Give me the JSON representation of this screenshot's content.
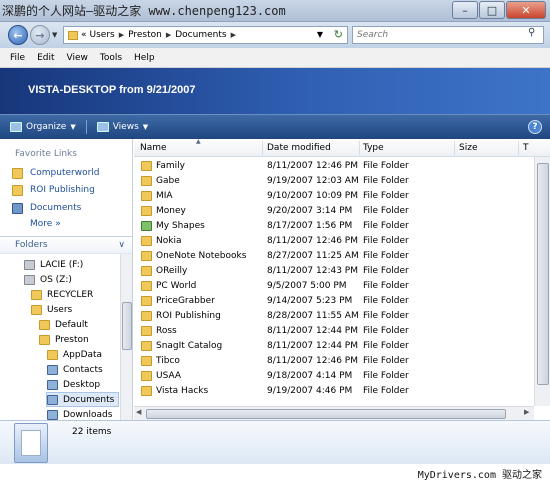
{
  "titlebar": {
    "watermark": "深鹏的个人网站—驱动之家 www.chenpeng123.com"
  },
  "address": {
    "prefix": "«",
    "crumbs": [
      "Users",
      "Preston",
      "Documents"
    ],
    "search_placeholder": "Search"
  },
  "menu": [
    "File",
    "Edit",
    "View",
    "Tools",
    "Help"
  ],
  "banner": {
    "title": "VISTA-DESKTOP from 9/21/2007"
  },
  "toolbar": {
    "organize": "Organize",
    "views": "Views",
    "help": "?"
  },
  "favorites": {
    "title": "Favorite Links",
    "items": [
      "Computerworld",
      "ROI Publishing",
      "Documents"
    ],
    "more": "More",
    "more_glyph": "»"
  },
  "folders": {
    "title": "Folders",
    "tree": [
      "LACIE (F:)",
      "OS (Z:)",
      "RECYCLER",
      "Users",
      "Default",
      "Preston",
      "AppData",
      "Contacts",
      "Desktop",
      "Documents",
      "Downloads"
    ]
  },
  "columns": [
    "Name",
    "Date modified",
    "Type",
    "Size",
    "T"
  ],
  "files": [
    {
      "name": "Family",
      "date": "8/11/2007 12:46 PM",
      "type": "File Folder"
    },
    {
      "name": "Gabe",
      "date": "9/19/2007 12:03 AM",
      "type": "File Folder"
    },
    {
      "name": "MIA",
      "date": "9/10/2007 10:09 PM",
      "type": "File Folder"
    },
    {
      "name": "Money",
      "date": "9/20/2007 3:14 PM",
      "type": "File Folder"
    },
    {
      "name": "My Shapes",
      "date": "8/17/2007 1:56 PM",
      "type": "File Folder"
    },
    {
      "name": "Nokia",
      "date": "8/11/2007 12:46 PM",
      "type": "File Folder"
    },
    {
      "name": "OneNote Notebooks",
      "date": "8/27/2007 11:25 AM",
      "type": "File Folder"
    },
    {
      "name": "OReilly",
      "date": "8/11/2007 12:43 PM",
      "type": "File Folder"
    },
    {
      "name": "PC World",
      "date": "9/5/2007 5:00 PM",
      "type": "File Folder"
    },
    {
      "name": "PriceGrabber",
      "date": "9/14/2007 5:23 PM",
      "type": "File Folder"
    },
    {
      "name": "ROI Publishing",
      "date": "8/28/2007 11:55 AM",
      "type": "File Folder"
    },
    {
      "name": "Ross",
      "date": "8/11/2007 12:44 PM",
      "type": "File Folder"
    },
    {
      "name": "SnagIt Catalog",
      "date": "8/11/2007 12:44 PM",
      "type": "File Folder"
    },
    {
      "name": "Tibco",
      "date": "8/11/2007 12:46 PM",
      "type": "File Folder"
    },
    {
      "name": "USAA",
      "date": "9/18/2007 4:14 PM",
      "type": "File Folder"
    },
    {
      "name": "Vista Hacks",
      "date": "9/19/2007 4:46 PM",
      "type": "File Folder"
    }
  ],
  "details": {
    "count": "22 items"
  },
  "caption": "MyDrivers.com 驱动之家"
}
